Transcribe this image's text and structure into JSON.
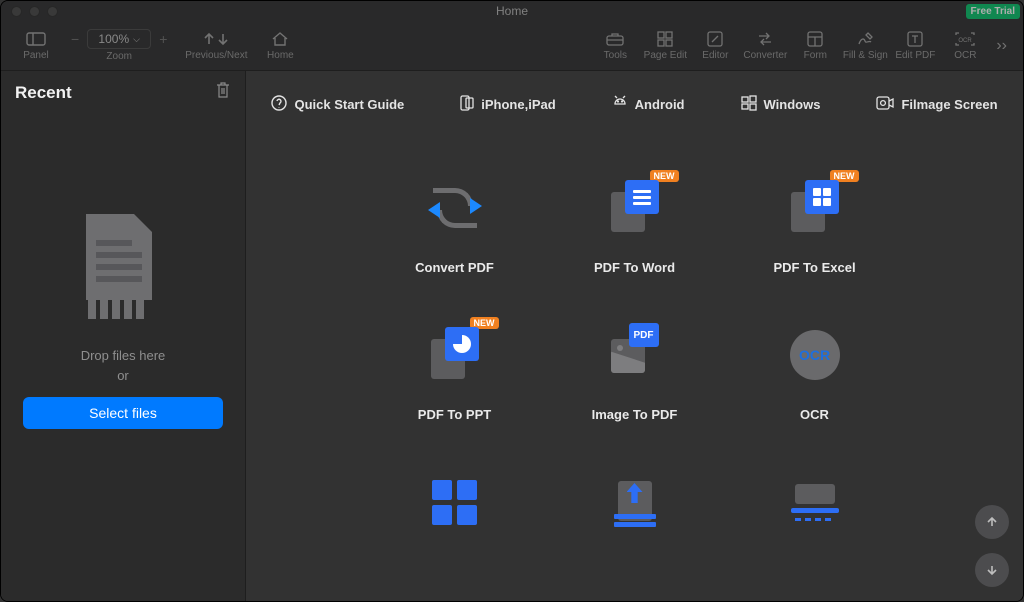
{
  "window": {
    "title": "Home",
    "free_trial": "Free Trial"
  },
  "toolbar": {
    "panel": "Panel",
    "zoom_label": "Zoom",
    "zoom_value": "100%",
    "prev_next": "Previous/Next",
    "home": "Home",
    "tools": "Tools",
    "page_edit": "Page Edit",
    "editor": "Editor",
    "converter": "Converter",
    "form": "Form",
    "fill_sign": "Fill & Sign",
    "edit_pdf": "Edit PDF",
    "ocr": "OCR"
  },
  "sidebar": {
    "heading": "Recent",
    "drop_line1": "Drop files here",
    "drop_line2": "or",
    "select_btn": "Select files"
  },
  "quickbar": [
    {
      "icon": "help-icon",
      "label": "Quick Start Guide"
    },
    {
      "icon": "phone-icon",
      "label": "iPhone,iPad"
    },
    {
      "icon": "android-icon",
      "label": "Android"
    },
    {
      "icon": "windows-icon",
      "label": "Windows"
    },
    {
      "icon": "record-icon",
      "label": "Filmage Screen"
    }
  ],
  "tiles": [
    {
      "label": "Convert PDF",
      "badge": null
    },
    {
      "label": "PDF To Word",
      "badge": "NEW"
    },
    {
      "label": "PDF To Excel",
      "badge": "NEW"
    },
    {
      "label": "PDF To PPT",
      "badge": "NEW"
    },
    {
      "label": "Image To PDF",
      "badge": null
    },
    {
      "label": "OCR",
      "badge": null
    }
  ],
  "ocr_glyph": "OCR"
}
